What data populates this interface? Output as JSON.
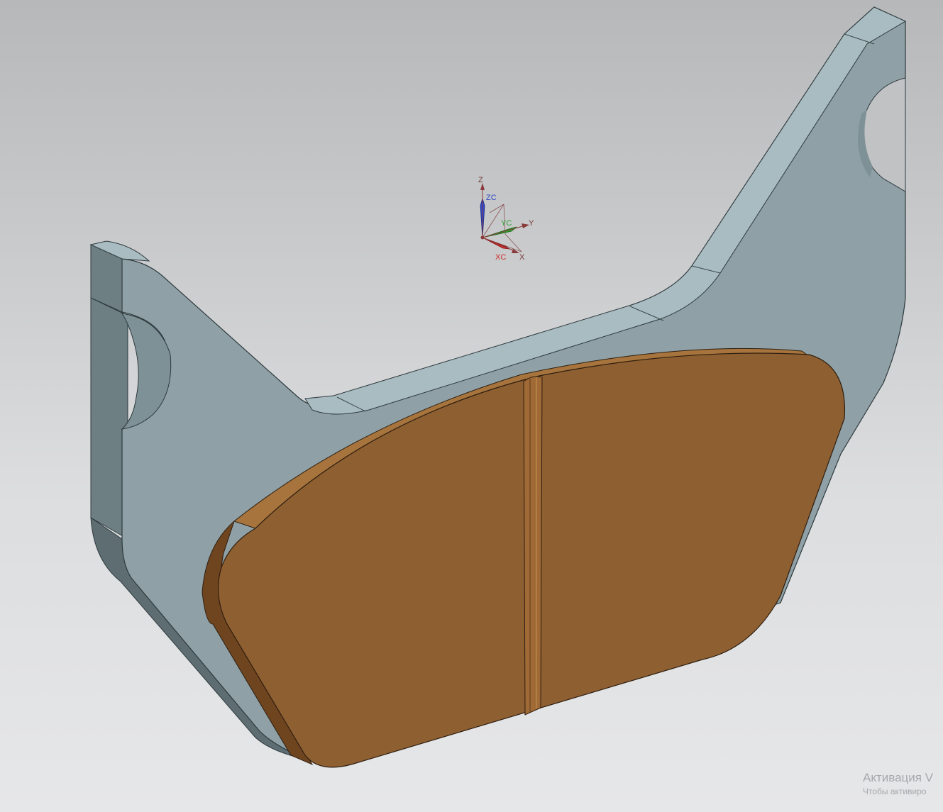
{
  "csys": {
    "z": "Z",
    "zc": "ZC",
    "y": "Y",
    "yc": "YC",
    "x": "X",
    "xc": "XC"
  },
  "model": {
    "bracket_color": "#8fa1a6",
    "bracket_top_color": "#a9bcc1",
    "bracket_side_color": "#6e7f84",
    "pad_color": "#8e5f31",
    "pad_edge_color": "#a6743c",
    "pad_side_color": "#6f4520"
  },
  "watermark": {
    "title": "Активация V",
    "subtitle": "Чтобы активиро"
  }
}
